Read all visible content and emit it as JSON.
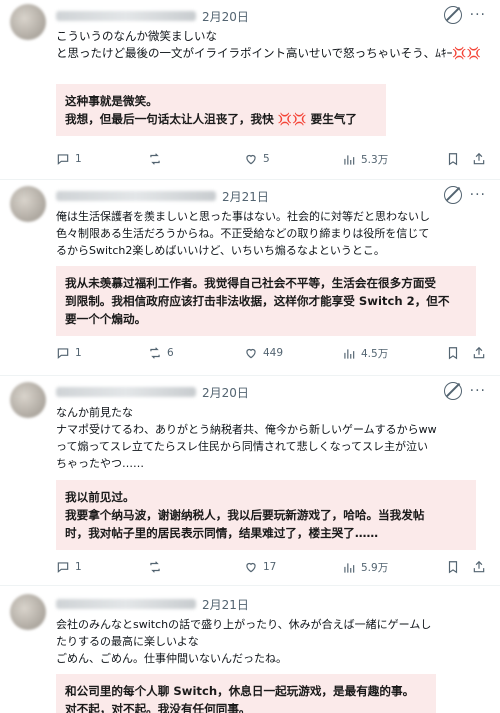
{
  "posts": [
    {
      "date": "2月20日",
      "lines": [
        "こういうのなんか微笑ましいな",
        "と思ったけど最後の一文がイライラポイント高いせいで怒っちゃいそう、ﾑｷｰ💢💢"
      ],
      "translation": [
        "这种事就是微笑。",
        "我想，但最后一句话太让人沮丧了，我快 💢💢 要生气了"
      ],
      "stats": {
        "replies": "1",
        "retweets": "",
        "likes": "5",
        "views": "5.3万"
      }
    },
    {
      "date": "2月21日",
      "lines": [
        "俺は生活保護者を羨ましいと思った事はない。社会的に対等だと思わないし",
        "色々制限ある生活だろうからね。不正受給などの取り締まりは役所を信じて",
        "るからSwitch2楽しめばいいけど、いちいち煽るなよというとこ。"
      ],
      "translation": [
        "我从未羡慕过福利工作者。我觉得自己社会不平等，生活会在很多方面受",
        "到限制。我相信政府应该打击非法收据，这样你才能享受 Switch 2，但不",
        "要一个个煽动。"
      ],
      "stats": {
        "replies": "1",
        "retweets": "6",
        "likes": "449",
        "views": "4.5万"
      }
    },
    {
      "date": "2月20日",
      "lines": [
        "なんか前見たな",
        "ナマポ受けてるわ、ありがとう納税者共、俺今から新しいゲームするからww",
        "って煽ってスレ立てたらスレ住民から同情されて悲しくなってスレ主が泣い",
        "ちゃったやつ……"
      ],
      "translation": [
        "我以前见过。",
        "我要拿个纳马波，谢谢纳税人，我以后要玩新游戏了，哈哈。当我发帖",
        "时，我对帖子里的居民表示同情，结果难过了，楼主哭了……"
      ],
      "stats": {
        "replies": "1",
        "retweets": "",
        "likes": "17",
        "views": "5.9万"
      }
    },
    {
      "date": "2月21日",
      "lines": [
        "会社のみんなとswitchの話で盛り上がったり、休みが合えば一緒にゲームし",
        "たりするの最高に楽しいよな",
        "ごめん、ごめん。仕事仲間いないんだったね。"
      ],
      "translation": [
        "和公司里的每个人聊 Switch，休息日一起玩游戏，是最有趣的事。",
        "对不起，对不起。我没有任何同事。"
      ],
      "stats": {
        "replies": "",
        "retweets": "",
        "likes": "",
        "views": ""
      }
    }
  ],
  "icons": {
    "grok": "grok-slash-circle-icon",
    "more": "more-dots-icon",
    "reply": "reply-bubble-icon",
    "retweet": "retweet-arrows-icon",
    "like": "heart-icon",
    "views": "views-bar-chart-icon",
    "bookmark": "bookmark-icon",
    "share": "share-upload-icon"
  },
  "colors": {
    "translation_bg": "#fbeaea",
    "muted": "#536471",
    "text": "#0f1419"
  }
}
